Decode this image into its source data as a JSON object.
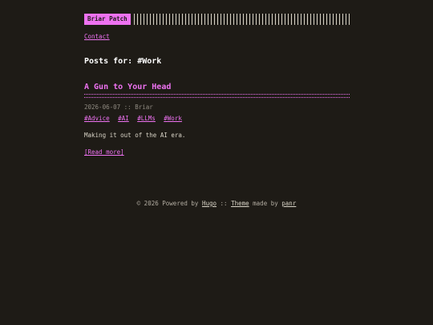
{
  "header": {
    "logo": "Briar Patch"
  },
  "nav": {
    "contact": "Contact"
  },
  "page_title": "Posts for: #Work",
  "post": {
    "title": "A Gun to Your Head",
    "date": "2026-06-07",
    "separator": "::",
    "author": "Briar",
    "tags": [
      "Advice",
      "AI",
      "LLMs",
      "Work"
    ],
    "excerpt": "Making it out of the AI era.",
    "read_more": "[Read more]"
  },
  "footer": {
    "copyright": "© 2026 Powered by",
    "hugo": "Hugo",
    "separator": "::",
    "theme": "Theme",
    "made_by": "made by",
    "author": "panr"
  },
  "colors": {
    "background": "#1e1b16",
    "accent": "#ee72f1",
    "text": "#d9d4c7"
  }
}
